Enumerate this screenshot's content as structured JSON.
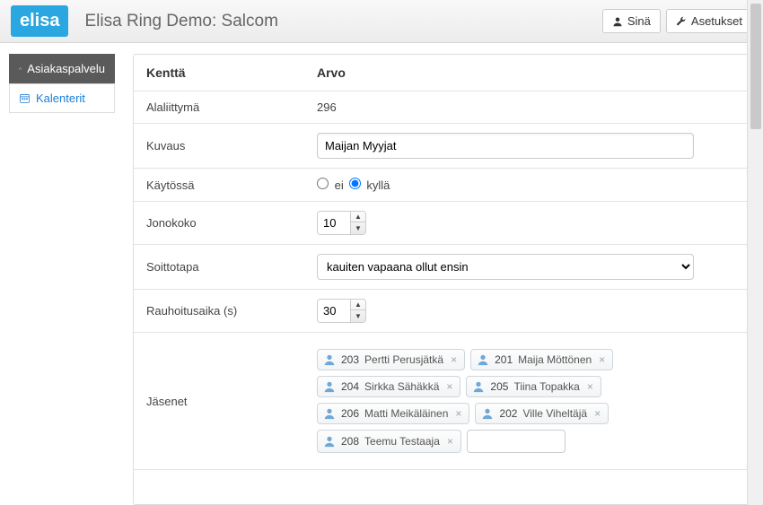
{
  "header": {
    "logo": "elisa",
    "title": "Elisa Ring Demo: Salcom",
    "user_button": "Sinä",
    "settings_button": "Asetukset"
  },
  "sidebar": {
    "items": [
      {
        "label": "Asiakaspalvelu",
        "active": true
      },
      {
        "label": "Kalenterit",
        "active": false
      }
    ]
  },
  "table": {
    "head_field": "Kenttä",
    "head_value": "Arvo",
    "extension_label": "Alaliittymä",
    "extension_value": "296",
    "description_label": "Kuvaus",
    "description_value": "Maijan Myyjat",
    "enabled_label": "Käytössä",
    "enabled_no": "ei",
    "enabled_yes": "kyllä",
    "enabled_selected": "yes",
    "queue_label": "Jonokoko",
    "queue_value": "10",
    "callmode_label": "Soittotapa",
    "callmode_value": "kauiten vapaana ollut ensin",
    "cooldown_label": "Rauhoitusaika (s)",
    "cooldown_value": "30",
    "members_label": "Jäsenet",
    "members": [
      {
        "num": "203",
        "name": "Pertti Perusjätkä"
      },
      {
        "num": "201",
        "name": "Maija Möttönen"
      },
      {
        "num": "204",
        "name": "Sirkka Sähäkkä"
      },
      {
        "num": "205",
        "name": "Tiina Topakka"
      },
      {
        "num": "206",
        "name": "Matti Meikäläinen"
      },
      {
        "num": "202",
        "name": "Ville Viheltäjä"
      },
      {
        "num": "208",
        "name": "Teemu Testaaja"
      }
    ]
  }
}
